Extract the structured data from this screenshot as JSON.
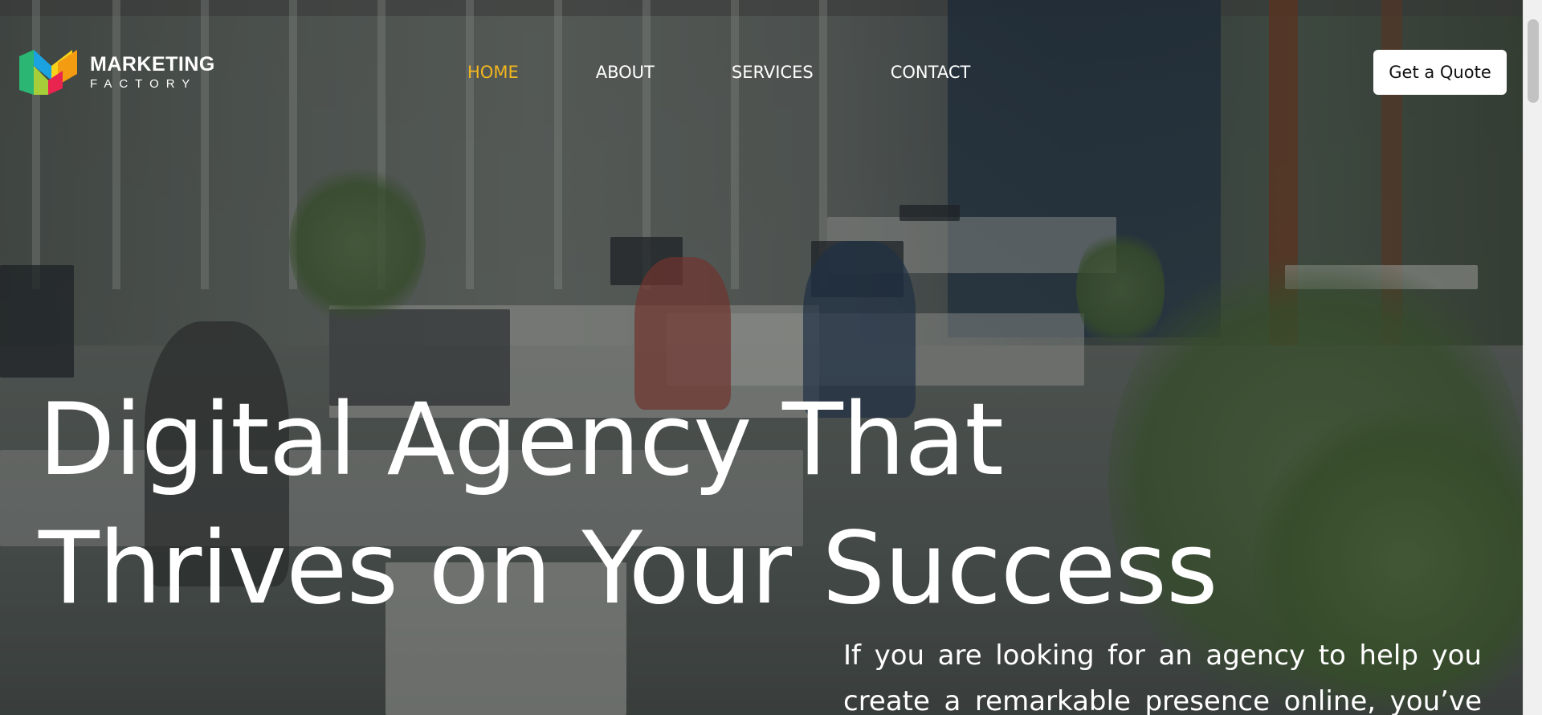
{
  "brand": {
    "name_line1": "MARKETING",
    "name_line2": "FACTORY"
  },
  "nav": {
    "items": [
      {
        "label": "HOME",
        "active": true
      },
      {
        "label": "ABOUT",
        "active": false
      },
      {
        "label": "SERVICES",
        "active": false
      },
      {
        "label": "CONTACT",
        "active": false
      }
    ]
  },
  "header": {
    "cta_label": "Get a Quote"
  },
  "hero": {
    "headline_line1": "Digital Agency That",
    "headline_line2": "Thrives on Your Success",
    "lead_text": "If you are looking for an agency to help you create a remarkable presence online, you’ve"
  },
  "colors": {
    "accent": "#f2b61e",
    "text": "#ffffff",
    "button_bg": "#ffffff"
  },
  "icons": {
    "logo": "marketing-factory-logo-mark"
  }
}
